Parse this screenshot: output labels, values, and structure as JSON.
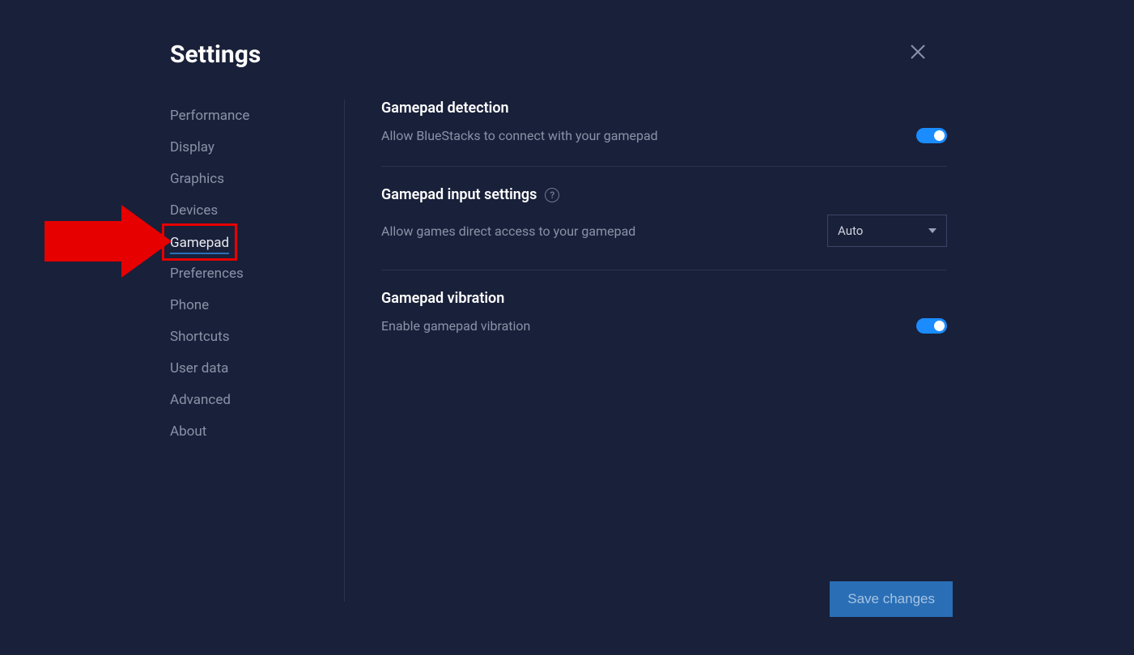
{
  "title": "Settings",
  "sidebar": {
    "items": [
      {
        "label": "Performance"
      },
      {
        "label": "Display"
      },
      {
        "label": "Graphics"
      },
      {
        "label": "Devices"
      },
      {
        "label": "Gamepad",
        "active": true
      },
      {
        "label": "Preferences"
      },
      {
        "label": "Phone"
      },
      {
        "label": "Shortcuts"
      },
      {
        "label": "User data"
      },
      {
        "label": "Advanced"
      },
      {
        "label": "About"
      }
    ]
  },
  "sections": {
    "detection": {
      "title": "Gamepad detection",
      "desc": "Allow BlueStacks to connect with your gamepad",
      "enabled": true
    },
    "input": {
      "title": "Gamepad input settings",
      "desc": "Allow games direct access to your gamepad",
      "select_value": "Auto"
    },
    "vibration": {
      "title": "Gamepad vibration",
      "desc": "Enable gamepad vibration",
      "enabled": true
    }
  },
  "save_label": "Save changes"
}
